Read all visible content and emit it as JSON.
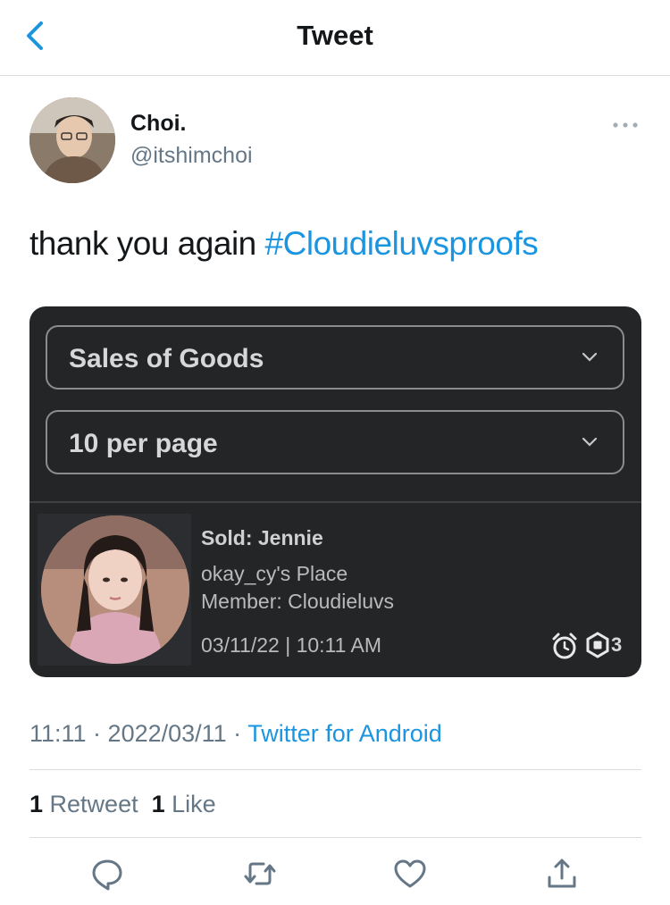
{
  "header": {
    "title": "Tweet",
    "back_icon": "chevron-left-icon"
  },
  "author": {
    "name": "Choi.",
    "handle": "@itshimchoi",
    "more_icon": "more-horizontal-icon"
  },
  "tweet": {
    "text": "thank you again ",
    "hashtag": "#Cloudieluvsproofs"
  },
  "card": {
    "dropdown1": "Sales of Goods",
    "dropdown2": "10 per page",
    "sale": {
      "sold": "Sold: Jennie",
      "place": "okay_cy's Place",
      "member": "Member: Cloudieluvs",
      "datetime": "03/11/22 | 10:11 AM",
      "robux": "3"
    }
  },
  "meta": {
    "time": "11:11 · 2022/03/11 · ",
    "source": "Twitter for Android"
  },
  "stats": {
    "retweet_count": "1",
    "retweet_label": " Retweet",
    "like_count": "1",
    "like_label": " Like"
  },
  "actions": [
    "reply-icon",
    "retweet-icon",
    "like-icon",
    "share-icon"
  ],
  "colors": {
    "link": "#1b95e0",
    "secondary": "#657786",
    "card_bg": "#232527"
  }
}
